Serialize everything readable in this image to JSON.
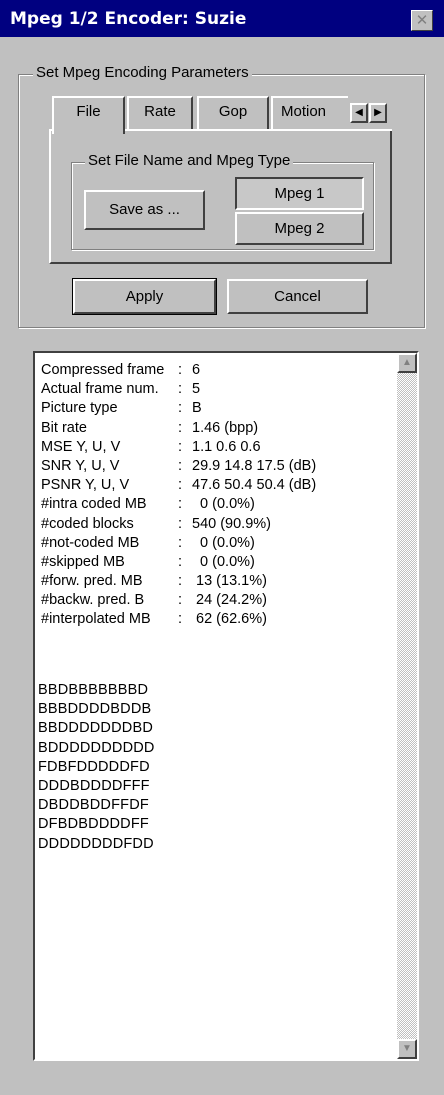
{
  "window": {
    "title": "Mpeg 1/2 Encoder: Suzie",
    "close_glyph": "✕"
  },
  "params_group": {
    "label": "Set Mpeg Encoding Parameters"
  },
  "tabs": [
    {
      "label": "File",
      "active": true
    },
    {
      "label": "Rate"
    },
    {
      "label": "Gop"
    },
    {
      "label": "Motion"
    }
  ],
  "tab_scroll": {
    "left_icon": "arrow-left-icon",
    "right_icon": "arrow-right-icon"
  },
  "file_group": {
    "label": "Set File Name and Mpeg Type"
  },
  "buttons": {
    "save_as": "Save as ...",
    "mpeg1": "Mpeg 1",
    "mpeg2": "Mpeg 2",
    "apply": "Apply",
    "cancel": "Cancel"
  },
  "selected_mpeg_type": "Mpeg 1",
  "stats": [
    {
      "label": "Compressed frame",
      "value": "6"
    },
    {
      "label": "Actual frame num.",
      "value": "5"
    },
    {
      "label": "Picture type",
      "value": "B"
    },
    {
      "label": "Bit rate",
      "value": "1.46 (bpp)"
    },
    {
      "label": "MSE Y, U, V",
      "value": "1.1  0.6  0.6"
    },
    {
      "label": "SNR Y, U, V",
      "value": "29.9  14.8  17.5 (dB)"
    },
    {
      "label": "PSNR Y, U, V",
      "value": "47.6  50.4  50.4 (dB)"
    },
    {
      "label": "#intra coded MB",
      "value": "  0 (0.0%)"
    },
    {
      "label": "#coded blocks",
      "value": "540 (90.9%)"
    },
    {
      "label": "#not-coded MB",
      "value": "  0 (0.0%)"
    },
    {
      "label": "#skipped MB",
      "value": "  0 (0.0%)"
    },
    {
      "label": "#forw. pred. MB",
      "value": " 13 (13.1%)"
    },
    {
      "label": "#backw. pred. B",
      "value": " 24 (24.2%)"
    },
    {
      "label": "#interpolated MB",
      "value": " 62 (62.6%)"
    }
  ],
  "mb_rows": [
    "BBDBBBBBBBD",
    "BBBDDDDBDDB",
    "BBDDDDDDDBD",
    "BDDDDDDDDDD",
    "FDBFDDDDDFD",
    "DDDBDDDDFFF",
    "DBDDBDDFFDF",
    "DFBDBDDDDFF",
    "DDDDDDDDFDD"
  ],
  "scrollbar": {
    "up_icon": "scroll-up-icon",
    "down_icon": "scroll-down-icon"
  }
}
